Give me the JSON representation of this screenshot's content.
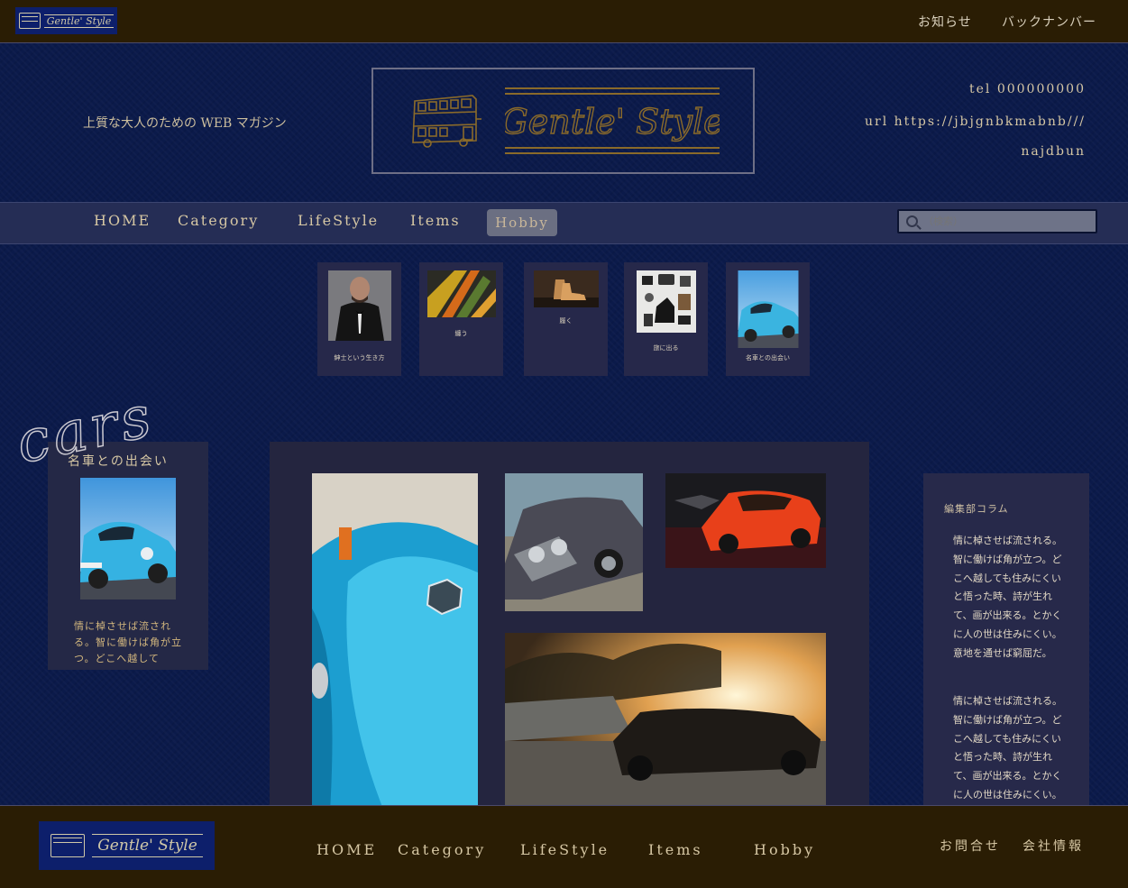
{
  "topbar": {
    "logo_text": "Gentle' Style",
    "links": [
      "お知らせ",
      "バックナンバー"
    ]
  },
  "header": {
    "tagline": "上質な大人のための WEB マガジン",
    "logo_text": "Gentle' Style",
    "contact": {
      "tel": "tel 000000000",
      "url": "url https://jbjgnbkmabnb///",
      "name": "najdbun"
    }
  },
  "nav": {
    "items": [
      "HOME",
      "Category",
      "LifeStyle",
      "Items",
      "Hobby"
    ],
    "active": "Hobby",
    "search_placeholder": "（検索）"
  },
  "categories": [
    {
      "label": "紳士という生き方"
    },
    {
      "label": "纏う"
    },
    {
      "label": "履く"
    },
    {
      "label": "旅に出る"
    },
    {
      "label": "名車との出会い"
    }
  ],
  "feature": {
    "script_word": "cars",
    "title": "名車との出会い",
    "excerpt": "情に棹させば流される。智に働けば角が立つ。どこへ越して"
  },
  "column": {
    "title": "編集部コラム",
    "paragraphs": [
      "情に棹させば流される。智に働けば角が立つ。どこへ越しても住みにくいと悟った時、詩が生れて、画が出来る。とかくに人の世は住みにくい。意地を通せば窮屈だ。",
      "情に棹させば流される。智に働けば角が立つ。どこへ越しても住みにくいと悟った時、詩が生れて、画が出来る。とかくに人の世は住みにくい。意地"
    ]
  },
  "footer": {
    "logo_text": "Gentle' Style",
    "nav": [
      "HOME",
      "Category",
      "LifeStyle",
      "Items",
      "Hobby"
    ],
    "links": [
      "お問合せ",
      "会社情報"
    ]
  },
  "colors": {
    "background": "#0b1a4a",
    "bar": "#2a1d04",
    "gold": "#d6c7a4",
    "logo_gold": "#8a6a2a"
  }
}
